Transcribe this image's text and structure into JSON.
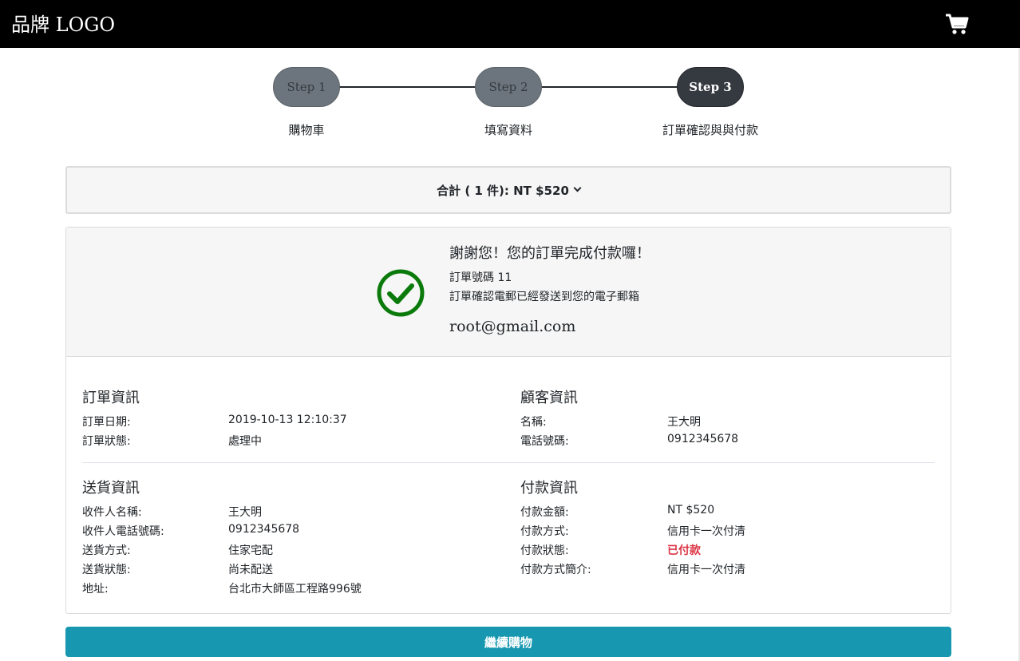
{
  "navbar": {
    "brand": "品牌 LOGO",
    "cart_icon": "shopping-cart-icon"
  },
  "steps": [
    {
      "badge": "Step 1",
      "label": "購物車",
      "state": "done"
    },
    {
      "badge": "Step 2",
      "label": "填寫資料",
      "state": "done"
    },
    {
      "badge": "Step 3",
      "label": "訂單確認與與付款",
      "state": "active"
    }
  ],
  "summary": {
    "text": "合計 ( 1  件): NT $520",
    "icon": "chevron-down-icon"
  },
  "confirmation": {
    "icon": "check-circle-icon",
    "thanks": "謝謝您！您的訂單完成付款囉！",
    "order_number": "訂單號碼 11",
    "email_sent": "訂單確認電郵已經發送到您的電子郵箱",
    "email": "root@gmail.com"
  },
  "order_info": {
    "title": "訂單資訊",
    "rows": [
      {
        "label": "訂單日期:",
        "value": "2019-10-13 12:10:37"
      },
      {
        "label": "訂單狀態:",
        "value": "處理中"
      }
    ]
  },
  "customer_info": {
    "title": "顧客資訊",
    "rows": [
      {
        "label": "名稱:",
        "value": "王大明"
      },
      {
        "label": "電話號碼:",
        "value": "0912345678"
      }
    ]
  },
  "shipping_info": {
    "title": "送貨資訊",
    "rows": [
      {
        "label": "收件人名稱:",
        "value": "王大明"
      },
      {
        "label": "收件人電話號碼:",
        "value": "0912345678"
      },
      {
        "label": "送貨方式:",
        "value": "住家宅配"
      },
      {
        "label": "送貨狀態:",
        "value": "尚未配送"
      },
      {
        "label": "地址:",
        "value": "台北市大師區工程路996號"
      }
    ]
  },
  "payment_info": {
    "title": "付款資訊",
    "rows": [
      {
        "label": "付款金額:",
        "value": "NT $520"
      },
      {
        "label": "付款方式:",
        "value": "信用卡一次付清"
      },
      {
        "label": "付款狀態:",
        "value": "已付款"
      },
      {
        "label": "付款方式簡介:",
        "value": "信用卡一次付清"
      }
    ]
  },
  "colors": {
    "navbar": "#000000",
    "step_done": "#6c757d",
    "step_active": "#343a40",
    "success": "#0a7a0a",
    "paid_status": "#dc3545",
    "continue_button": "#1797b0"
  },
  "continue_button": {
    "label": "繼續購物"
  }
}
